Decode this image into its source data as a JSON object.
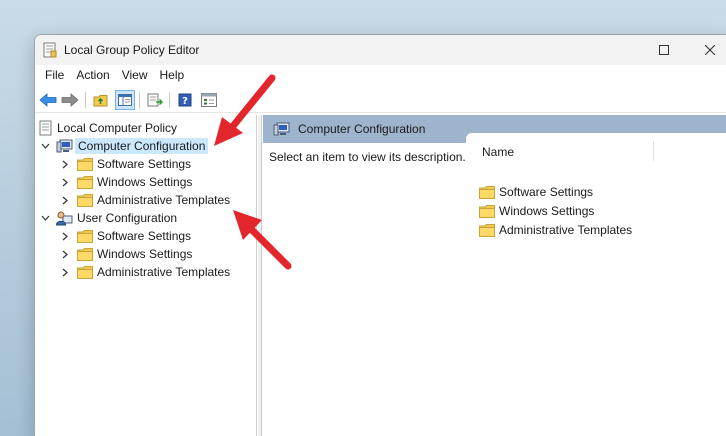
{
  "window": {
    "title": "Local Group Policy Editor",
    "icons": {
      "app": "policy-document-icon",
      "maximize": "maximize-icon",
      "close": "close-icon"
    }
  },
  "menu": [
    "File",
    "Action",
    "View",
    "Help"
  ],
  "toolbar": {
    "buttons": [
      "back-arrow-icon",
      "forward-arrow-icon",
      "up-folder-icon",
      "show-hide-console-tree-icon",
      "export-list-icon",
      "help-icon",
      "properties-icon"
    ]
  },
  "tree": {
    "root": "Local Computer Policy",
    "computer": {
      "label": "Computer Configuration",
      "children": [
        "Software Settings",
        "Windows Settings",
        "Administrative Templates"
      ]
    },
    "user": {
      "label": "User Configuration",
      "children": [
        "Software Settings",
        "Windows Settings",
        "Administrative Templates"
      ]
    }
  },
  "details": {
    "header": "Computer Configuration",
    "description": "Select an item to view its description.",
    "column": "Name",
    "items": [
      "Software Settings",
      "Windows Settings",
      "Administrative Templates"
    ]
  },
  "colors": {
    "selection": "#cce8ff",
    "header_band": "#9db4cc",
    "folder": "#f2c94c",
    "annotation_arrow": "#e3262b"
  }
}
